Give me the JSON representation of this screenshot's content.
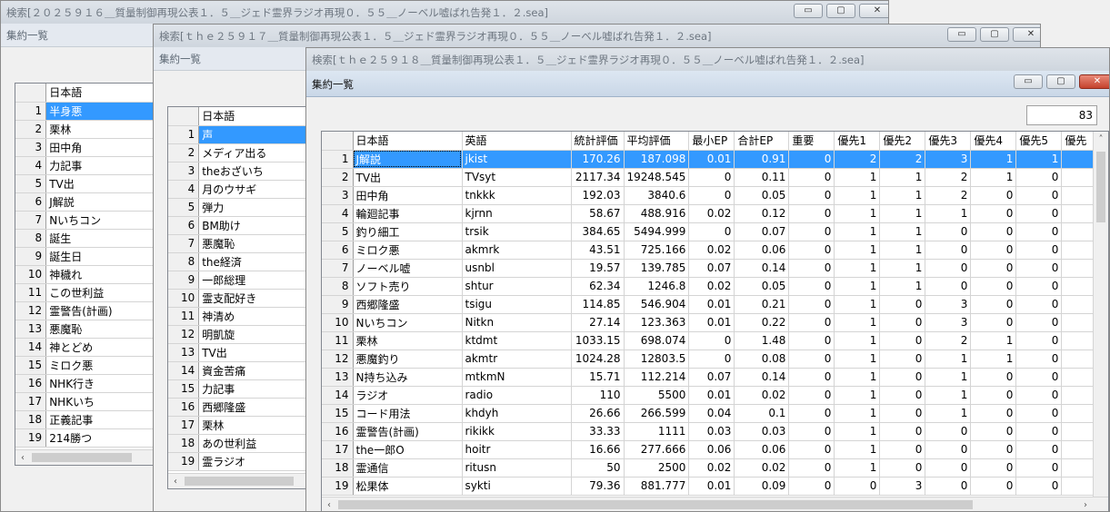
{
  "window1": {
    "title": "検索[２０２５９１６＿質量制御再現公表１．５＿ジェド霊界ラジオ再現０．５５＿ノーベル嘘ばれ告発１．２.sea]",
    "subtitle": "集約一覧",
    "header": "日本語",
    "rows": [
      {
        "n": "1",
        "ja": "半身悪"
      },
      {
        "n": "2",
        "ja": "栗林"
      },
      {
        "n": "3",
        "ja": "田中角"
      },
      {
        "n": "4",
        "ja": "力記事"
      },
      {
        "n": "5",
        "ja": "TV出"
      },
      {
        "n": "6",
        "ja": "J解説"
      },
      {
        "n": "7",
        "ja": "Nいちコン"
      },
      {
        "n": "8",
        "ja": "誕生"
      },
      {
        "n": "9",
        "ja": "誕生日"
      },
      {
        "n": "10",
        "ja": "神穢れ"
      },
      {
        "n": "11",
        "ja": "この世利益"
      },
      {
        "n": "12",
        "ja": "霊警告(計画)"
      },
      {
        "n": "13",
        "ja": "悪魔恥"
      },
      {
        "n": "14",
        "ja": "神とどめ"
      },
      {
        "n": "15",
        "ja": "ミロク悪"
      },
      {
        "n": "16",
        "ja": "NHK行き"
      },
      {
        "n": "17",
        "ja": "NHKいち"
      },
      {
        "n": "18",
        "ja": "正義記事"
      },
      {
        "n": "19",
        "ja": "214勝つ"
      }
    ]
  },
  "window2": {
    "title": "検索[ｔｈｅ２５９１７＿質量制御再現公表１．５＿ジェド霊界ラジオ再現０．５５＿ノーベル嘘ばれ告発１．２.sea]",
    "subtitle": "集約一覧",
    "header": "日本語",
    "rows": [
      {
        "n": "1",
        "ja": "声"
      },
      {
        "n": "2",
        "ja": "メディア出る"
      },
      {
        "n": "3",
        "ja": "theおざいち"
      },
      {
        "n": "4",
        "ja": "月のウサギ"
      },
      {
        "n": "5",
        "ja": "弾力"
      },
      {
        "n": "6",
        "ja": "BM助け"
      },
      {
        "n": "7",
        "ja": "悪魔恥"
      },
      {
        "n": "8",
        "ja": "the経済"
      },
      {
        "n": "9",
        "ja": "一郎総理"
      },
      {
        "n": "10",
        "ja": "霊支配好き"
      },
      {
        "n": "11",
        "ja": "神清め"
      },
      {
        "n": "12",
        "ja": "明凱旋"
      },
      {
        "n": "13",
        "ja": "TV出"
      },
      {
        "n": "14",
        "ja": "資金苦痛"
      },
      {
        "n": "15",
        "ja": "力記事"
      },
      {
        "n": "16",
        "ja": "西郷隆盛"
      },
      {
        "n": "17",
        "ja": "栗林"
      },
      {
        "n": "18",
        "ja": "あの世利益"
      },
      {
        "n": "19",
        "ja": "霊ラジオ"
      }
    ]
  },
  "window3": {
    "title": "検索[ｔｈｅ２５９１８＿質量制御再現公表１．５＿ジェド霊界ラジオ再現０．５５＿ノーベル嘘ばれ告発１．２.sea]",
    "subtitle": "集約一覧",
    "inner_title": "集約一覧",
    "count": "83",
    "headers": [
      "日本語",
      "英語",
      "統計評価",
      "平均評価",
      "最小EP",
      "合計EP",
      "重要",
      "優先1",
      "優先2",
      "優先3",
      "優先4",
      "優先5",
      "優先"
    ],
    "rows": [
      {
        "n": "1",
        "ja": "J解説",
        "en": "jkist",
        "stat": "170.26",
        "avg": "187.098",
        "minep": "0.01",
        "sumep": "0.91",
        "imp": "0",
        "p1": "2",
        "p2": "2",
        "p3": "3",
        "p4": "1",
        "p5": "1"
      },
      {
        "n": "2",
        "ja": "TV出",
        "en": "TVsyt",
        "stat": "2117.34",
        "avg": "19248.545",
        "minep": "0",
        "sumep": "0.11",
        "imp": "0",
        "p1": "1",
        "p2": "1",
        "p3": "2",
        "p4": "1",
        "p5": "0"
      },
      {
        "n": "3",
        "ja": "田中角",
        "en": "tnkkk",
        "stat": "192.03",
        "avg": "3840.6",
        "minep": "0",
        "sumep": "0.05",
        "imp": "0",
        "p1": "1",
        "p2": "1",
        "p3": "2",
        "p4": "0",
        "p5": "0"
      },
      {
        "n": "4",
        "ja": "輪廻記事",
        "en": "kjrnn",
        "stat": "58.67",
        "avg": "488.916",
        "minep": "0.02",
        "sumep": "0.12",
        "imp": "0",
        "p1": "1",
        "p2": "1",
        "p3": "1",
        "p4": "0",
        "p5": "0"
      },
      {
        "n": "5",
        "ja": "釣り細工",
        "en": "trsik",
        "stat": "384.65",
        "avg": "5494.999",
        "minep": "0",
        "sumep": "0.07",
        "imp": "0",
        "p1": "1",
        "p2": "1",
        "p3": "0",
        "p4": "0",
        "p5": "0"
      },
      {
        "n": "6",
        "ja": "ミロク悪",
        "en": "akmrk",
        "stat": "43.51",
        "avg": "725.166",
        "minep": "0.02",
        "sumep": "0.06",
        "imp": "0",
        "p1": "1",
        "p2": "1",
        "p3": "0",
        "p4": "0",
        "p5": "0"
      },
      {
        "n": "7",
        "ja": "ノーベル嘘",
        "en": "usnbl",
        "stat": "19.57",
        "avg": "139.785",
        "minep": "0.07",
        "sumep": "0.14",
        "imp": "0",
        "p1": "1",
        "p2": "1",
        "p3": "0",
        "p4": "0",
        "p5": "0"
      },
      {
        "n": "8",
        "ja": "ソフト売り",
        "en": "shtur",
        "stat": "62.34",
        "avg": "1246.8",
        "minep": "0.02",
        "sumep": "0.05",
        "imp": "0",
        "p1": "1",
        "p2": "1",
        "p3": "0",
        "p4": "0",
        "p5": "0"
      },
      {
        "n": "9",
        "ja": "西郷隆盛",
        "en": "tsigu",
        "stat": "114.85",
        "avg": "546.904",
        "minep": "0.01",
        "sumep": "0.21",
        "imp": "0",
        "p1": "1",
        "p2": "0",
        "p3": "3",
        "p4": "0",
        "p5": "0"
      },
      {
        "n": "10",
        "ja": "Nいちコン",
        "en": "Nitkn",
        "stat": "27.14",
        "avg": "123.363",
        "minep": "0.01",
        "sumep": "0.22",
        "imp": "0",
        "p1": "1",
        "p2": "0",
        "p3": "3",
        "p4": "0",
        "p5": "0"
      },
      {
        "n": "11",
        "ja": "栗林",
        "en": "ktdmt",
        "stat": "1033.15",
        "avg": "698.074",
        "minep": "0",
        "sumep": "1.48",
        "imp": "0",
        "p1": "1",
        "p2": "0",
        "p3": "2",
        "p4": "1",
        "p5": "0"
      },
      {
        "n": "12",
        "ja": "悪魔釣り",
        "en": "akmtr",
        "stat": "1024.28",
        "avg": "12803.5",
        "minep": "0",
        "sumep": "0.08",
        "imp": "0",
        "p1": "1",
        "p2": "0",
        "p3": "1",
        "p4": "1",
        "p5": "0"
      },
      {
        "n": "13",
        "ja": "N持ち込み",
        "en": "mtkmN",
        "stat": "15.71",
        "avg": "112.214",
        "minep": "0.07",
        "sumep": "0.14",
        "imp": "0",
        "p1": "1",
        "p2": "0",
        "p3": "1",
        "p4": "0",
        "p5": "0"
      },
      {
        "n": "14",
        "ja": "ラジオ",
        "en": "radio",
        "stat": "110",
        "avg": "5500",
        "minep": "0.01",
        "sumep": "0.02",
        "imp": "0",
        "p1": "1",
        "p2": "0",
        "p3": "1",
        "p4": "0",
        "p5": "0"
      },
      {
        "n": "15",
        "ja": "コード用法",
        "en": "khdyh",
        "stat": "26.66",
        "avg": "266.599",
        "minep": "0.04",
        "sumep": "0.1",
        "imp": "0",
        "p1": "1",
        "p2": "0",
        "p3": "1",
        "p4": "0",
        "p5": "0"
      },
      {
        "n": "16",
        "ja": "霊警告(計画)",
        "en": "rikikk",
        "stat": "33.33",
        "avg": "1111",
        "minep": "0.03",
        "sumep": "0.03",
        "imp": "0",
        "p1": "1",
        "p2": "0",
        "p3": "0",
        "p4": "0",
        "p5": "0"
      },
      {
        "n": "17",
        "ja": "the一郎O",
        "en": "hoitr",
        "stat": "16.66",
        "avg": "277.666",
        "minep": "0.06",
        "sumep": "0.06",
        "imp": "0",
        "p1": "1",
        "p2": "0",
        "p3": "0",
        "p4": "0",
        "p5": "0"
      },
      {
        "n": "18",
        "ja": "霊通信",
        "en": "ritusn",
        "stat": "50",
        "avg": "2500",
        "minep": "0.02",
        "sumep": "0.02",
        "imp": "0",
        "p1": "1",
        "p2": "0",
        "p3": "0",
        "p4": "0",
        "p5": "0"
      },
      {
        "n": "19",
        "ja": "松果体",
        "en": "sykti",
        "stat": "79.36",
        "avg": "881.777",
        "minep": "0.01",
        "sumep": "0.09",
        "imp": "0",
        "p1": "0",
        "p2": "3",
        "p3": "0",
        "p4": "0",
        "p5": "0"
      }
    ]
  },
  "controls": {
    "minimize": "▭",
    "maximize": "▢",
    "close": "✕"
  },
  "scroll": {
    "left": "‹",
    "right": "›",
    "up": "˄",
    "down": "˅"
  }
}
